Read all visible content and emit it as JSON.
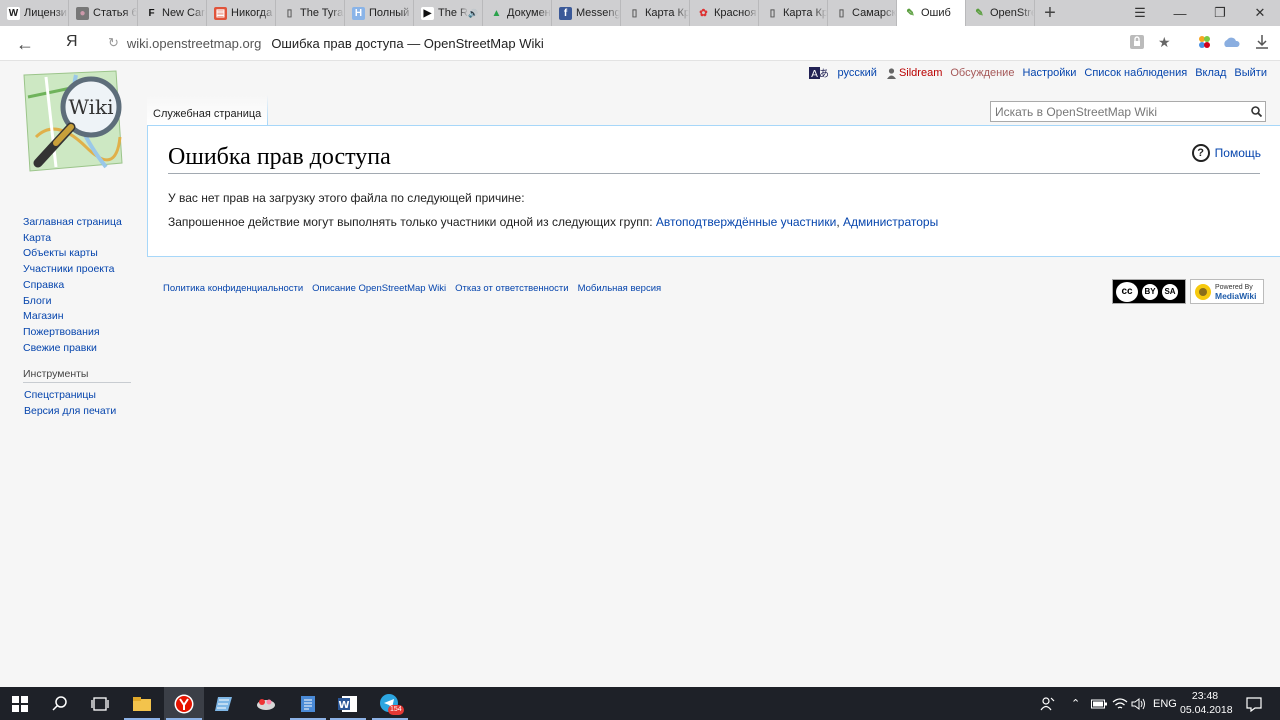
{
  "browser": {
    "tabs": [
      {
        "icon": "wikipedia-icon",
        "label": "Лицензи"
      },
      {
        "icon": "avatar-icon",
        "label": "Статья б"
      },
      {
        "icon": "f-icon",
        "label": "New Care"
      },
      {
        "icon": "newspaper-icon",
        "label": "Никогда"
      },
      {
        "icon": "page-icon",
        "label": "The Tyran"
      },
      {
        "icon": "h-icon",
        "label": "Полный"
      },
      {
        "icon": "play-icon",
        "label": "The R"
      },
      {
        "icon": "drive-icon",
        "label": "Докумен"
      },
      {
        "icon": "facebook-icon",
        "label": "Messeng"
      },
      {
        "icon": "page-icon",
        "label": "Карта Кр"
      },
      {
        "icon": "flower-icon",
        "label": "Красноя"
      },
      {
        "icon": "page-icon",
        "label": "Карта Кр"
      },
      {
        "icon": "page-icon",
        "label": "Самарск"
      },
      {
        "icon": "osm-icon",
        "label": "Ошиб"
      },
      {
        "icon": "osm-icon",
        "label": "OpenStre"
      }
    ],
    "active_tab_index": 13,
    "new_tab_label": "+",
    "address": {
      "host": "wiki.openstreetmap.org",
      "title": "Ошибка прав доступа — OpenStreetMap Wiki"
    },
    "yandex_label": "Я"
  },
  "wiki": {
    "personal": {
      "lang": "русский",
      "user": "Sildream",
      "talk": "Обсуждение",
      "prefs": "Настройки",
      "watchlist": "Список наблюдения",
      "contribs": "Вклад",
      "logout": "Выйти"
    },
    "namespace_tab": "Служебная страница",
    "search_placeholder": "Искать в OpenStreetMap Wiki",
    "heading": "Ошибка прав доступа",
    "help_label": "Помощь",
    "para1": "У вас нет прав на загрузку этого файла по следующей причине:",
    "para2_text": "Запрошенное действие могут выполнять только участники одной из следующих групп: ",
    "group1": "Автоподтверждённые участники",
    "sep": ", ",
    "group2": "Администраторы",
    "logo_text": "Wiki",
    "nav": [
      "Заглавная страница",
      "Карта",
      "Объекты карты",
      "Участники проекта",
      "Справка",
      "Блоги",
      "Магазин",
      "Пожертвования",
      "Свежие правки"
    ],
    "tools_heading": "Инструменты",
    "tools": [
      "Спецстраницы",
      "Версия для печати"
    ],
    "footer": [
      "Политика конфиденциальности",
      "Описание OpenStreetMap Wiki",
      "Отказ от ответственности",
      "Мобильная версия"
    ],
    "cc_badge": {
      "by": "BY",
      "sa": "SA"
    },
    "mediawiki_badge": {
      "line1": "Powered By",
      "line2": "MediaWiki"
    }
  },
  "taskbar": {
    "telegram_badge": "154",
    "lang": "ENG",
    "time": "23:48",
    "date": "05.04.2018"
  }
}
